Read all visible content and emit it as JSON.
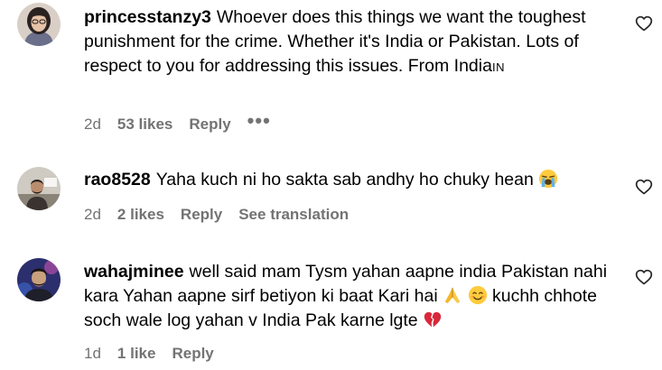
{
  "comments": [
    {
      "username": "princesstanzy3",
      "text": "Whoever does this things we want the toughest punishment for the crime. Whether it's India or Pakistan. Lots of respect to you for addressing this issues. From India",
      "flag": "IN",
      "time": "2d",
      "likes": "53 likes",
      "reply": "Reply",
      "more": "•••"
    },
    {
      "username": "rao8528",
      "text": "Yaha kuch ni ho sakta sab andhy ho chuky hean",
      "time": "2d",
      "likes": "2 likes",
      "reply": "Reply",
      "see_translation": "See translation"
    },
    {
      "username": "wahajminee",
      "text_part1": "well said mam Tysm yahan aapne india Pakistan nahi kara Yahan aapne sirf betiyon ki baat Kari hai",
      "text_part2": "kuchh chhote soch wale log yahan v India Pak karne lgte",
      "time": "1d",
      "likes": "1 like",
      "reply": "Reply"
    }
  ],
  "icons": {
    "heart": "heart-outline-icon",
    "crying": "loudly-crying-face-emoji",
    "pray": "folded-hands-emoji",
    "smile": "smiling-face-emoji",
    "broken_heart": "broken-heart-emoji"
  }
}
